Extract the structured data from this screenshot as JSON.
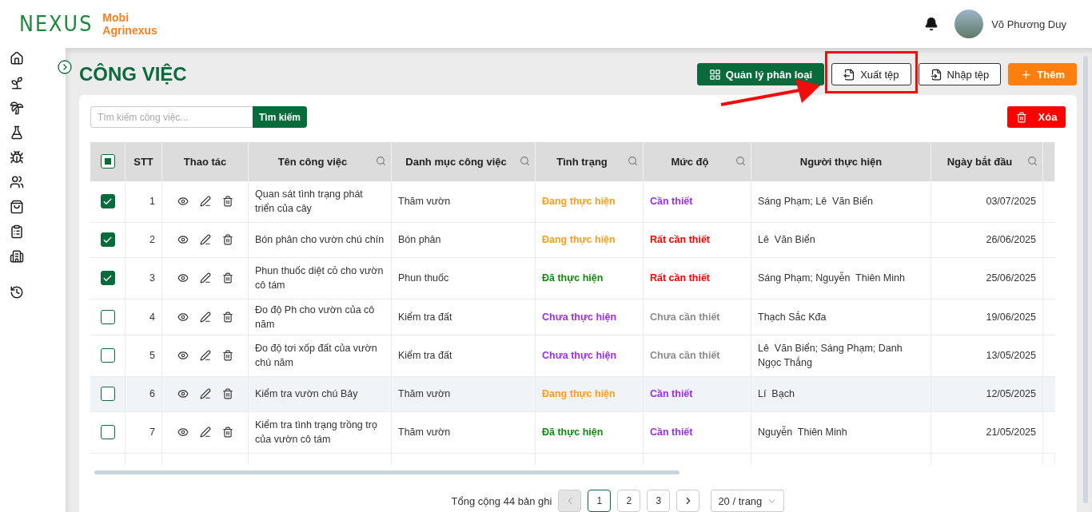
{
  "brand": {
    "logo": "NEXUS",
    "name_line1": "Mobi",
    "name_line2": "Agrinexus"
  },
  "user": {
    "name": "Võ Phương Duy"
  },
  "sidebar": {
    "items": [
      {
        "kind": "home"
      },
      {
        "kind": "plant"
      },
      {
        "kind": "tree"
      },
      {
        "kind": "flask"
      },
      {
        "kind": "bug"
      },
      {
        "kind": "users"
      },
      {
        "kind": "bag"
      },
      {
        "kind": "clipboard"
      },
      {
        "kind": "building"
      },
      {
        "kind": "history"
      }
    ]
  },
  "page_title": "CÔNG VIỆC",
  "actions": [
    {
      "kind": "categories",
      "label": "Quản lý phân loại",
      "annotated": false
    },
    {
      "kind": "export",
      "label": "Xuất tệp",
      "annotated": true
    },
    {
      "kind": "import",
      "label": "Nhập tệp",
      "annotated": false
    },
    {
      "kind": "add",
      "label": "Thêm",
      "annotated": false
    }
  ],
  "search": {
    "placeholder": "Tìm kiếm công việc...",
    "button": "Tìm kiếm"
  },
  "delete_button": "Xóa",
  "table": {
    "select_all": {
      "indeterminate": true
    },
    "columns": [
      {
        "label": "STT",
        "kind": "plain"
      },
      {
        "label": "Thao tác",
        "kind": "plain"
      },
      {
        "label": "Tên công việc",
        "kind": "search"
      },
      {
        "label": "Danh mục công việc",
        "kind": "search"
      },
      {
        "label": "Tình trạng",
        "kind": "search"
      },
      {
        "label": "Mức độ",
        "kind": "search"
      },
      {
        "label": "Người thực hiện",
        "kind": "plain"
      },
      {
        "label": "Ngày bắt đầu",
        "kind": "search"
      }
    ],
    "rows": [
      {
        "checked": true,
        "hovered": false,
        "stt": "1",
        "name": "Quan sát tình trạng phát triển của cây",
        "category": "Thăm vườn",
        "status": {
          "label": "Đang thực hiện",
          "color": "#f5a01e"
        },
        "priority": {
          "label": "Cần thiết",
          "color": "#9d2fe6"
        },
        "assignees": "Sáng Phạm; Lê  Văn Biển",
        "start_date": "03/07/2025"
      },
      {
        "checked": true,
        "hovered": false,
        "stt": "2",
        "name": "Bón phân cho vườn chú chín",
        "category": "Bón phân",
        "status": {
          "label": "Đang thực hiện",
          "color": "#f5a01e"
        },
        "priority": {
          "label": "Rất cần thiết",
          "color": "#ff0000"
        },
        "assignees": "Lê  Văn Biển",
        "start_date": "26/06/2025"
      },
      {
        "checked": true,
        "hovered": false,
        "stt": "3",
        "name": "Phun thuốc diệt cỏ cho vườn cô tám",
        "category": "Phun thuốc",
        "status": {
          "label": "Đã thực hiện",
          "color": "#128a12"
        },
        "priority": {
          "label": "Rất cần thiết",
          "color": "#ff0000"
        },
        "assignees": "Sáng Phạm; Nguyễn  Thiên Minh",
        "start_date": "25/06/2025"
      },
      {
        "checked": false,
        "hovered": false,
        "stt": "4",
        "name": "Đo độ Ph cho vườn của cô năm",
        "category": "Kiểm tra đất",
        "status": {
          "label": "Chưa thực hiện",
          "color": "#9d2fe6"
        },
        "priority": {
          "label": "Chưa cần thiết",
          "color": "#8c8c8c"
        },
        "assignees": "Thạch Sắc Kđa",
        "start_date": "19/06/2025"
      },
      {
        "checked": false,
        "hovered": false,
        "stt": "5",
        "name": "Đo độ tơi xốp đất của vườn chú năm",
        "category": "Kiểm tra đất",
        "status": {
          "label": "Chưa thực hiện",
          "color": "#9d2fe6"
        },
        "priority": {
          "label": "Chưa cần thiết",
          "color": "#8c8c8c"
        },
        "assignees": "Lê  Văn Biển; Sáng Phạm; Danh  Ngọc Thắng",
        "start_date": "13/05/2025"
      },
      {
        "checked": false,
        "hovered": true,
        "stt": "6",
        "name": "Kiểm tra vườn chú Bảy",
        "category": "Thăm vườn",
        "status": {
          "label": "Đang thực hiện",
          "color": "#f5a01e"
        },
        "priority": {
          "label": "Cần thiết",
          "color": "#9d2fe6"
        },
        "assignees": "Lí  Bạch",
        "start_date": "12/05/2025"
      },
      {
        "checked": false,
        "hovered": false,
        "stt": "7",
        "name": "Kiểm tra tình trạng trồng trọ của vườn cô tám",
        "category": "Thăm vườn",
        "status": {
          "label": "Đã thực hiện",
          "color": "#128a12"
        },
        "priority": {
          "label": "Cần thiết",
          "color": "#9d2fe6"
        },
        "assignees": "Nguyễn  Thiên Minh",
        "start_date": "21/05/2025"
      }
    ]
  },
  "pagination": {
    "total": "Tổng cộng 44 bản ghi",
    "prev_disabled": true,
    "pages": [
      {
        "label": "1",
        "selected": true
      },
      {
        "label": "2",
        "selected": false
      },
      {
        "label": "3",
        "selected": false
      }
    ],
    "page_size": "20 / trang"
  }
}
